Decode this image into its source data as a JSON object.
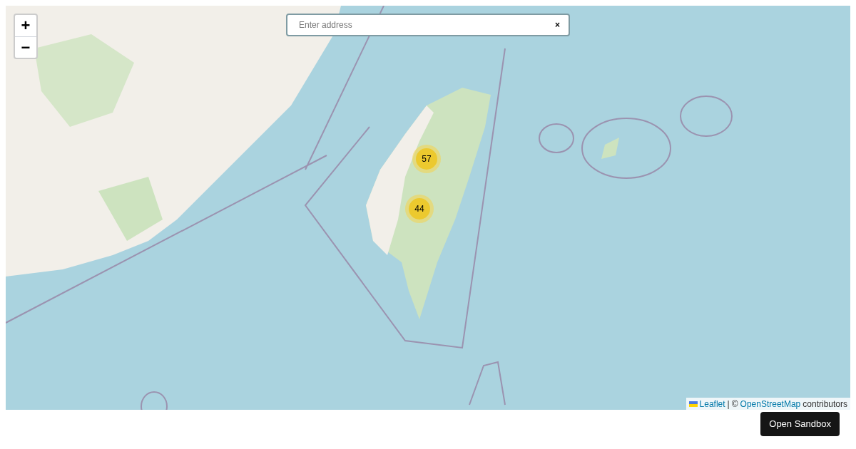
{
  "map": {
    "zoom_controls": [
      "+",
      "−"
    ],
    "search": {
      "placeholder": "Enter address",
      "clear": "×"
    },
    "clusters": [
      {
        "count": "57"
      },
      {
        "count": "44"
      }
    ],
    "attribution": [
      {
        "kind": "flag"
      },
      {
        "kind": "link",
        "text": "Leaflet"
      },
      {
        "kind": "text",
        "text": "|"
      },
      {
        "kind": "text",
        "text": "©"
      },
      {
        "kind": "link",
        "text": "OpenStreetMap"
      },
      {
        "kind": "text",
        "text": "contributors"
      }
    ]
  },
  "button": "Open Sandbox"
}
